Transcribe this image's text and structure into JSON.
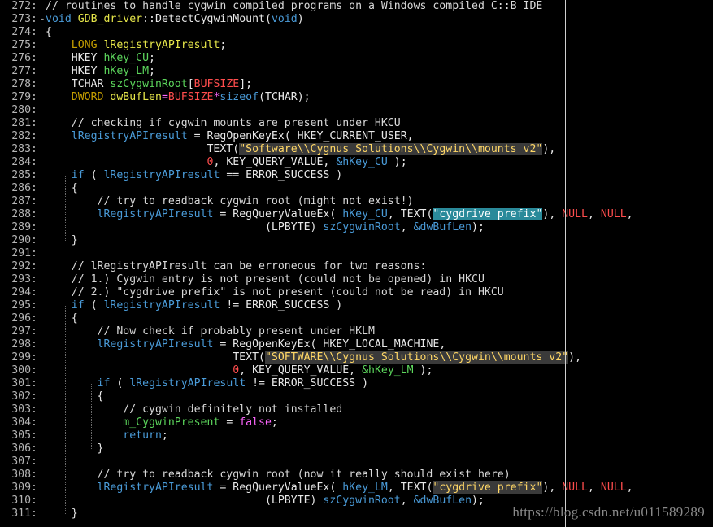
{
  "colors": {
    "background": "#000000",
    "line_number": "#b4b4b4",
    "comment": "#d8d8d8",
    "plain": "#e8e8e8",
    "keyword": "#4a9bd8",
    "type_keyword": "#c7a000",
    "identifier_yellow": "#e6e64a",
    "variable_green": "#5cd65c",
    "string": "#ffd766",
    "macro": "#ff4d4d",
    "number": "#ff4d4d",
    "operator": "#ff66ff",
    "highlight_bg": "#2a8a9a"
  },
  "lines": [
    {
      "n": "272:",
      "tokens": [
        {
          "t": "// routines to handle cygwin compiled programs on a Windows compiled C::B IDE",
          "c": "comment"
        }
      ]
    },
    {
      "n": "273:",
      "fold": true,
      "tokens": [
        {
          "t": "void ",
          "c": "keyword"
        },
        {
          "t": "GDB_driver",
          "c": "identifier_yellow"
        },
        {
          "t": "::",
          "c": "plain"
        },
        {
          "t": "DetectCygwinMount",
          "c": "plain"
        },
        {
          "t": "(",
          "c": "plain"
        },
        {
          "t": "void",
          "c": "keyword"
        },
        {
          "t": ")",
          "c": "plain"
        }
      ]
    },
    {
      "n": "274:",
      "tokens": [
        {
          "t": "{",
          "c": "plain"
        }
      ]
    },
    {
      "n": "275:",
      "tokens": [
        {
          "t": "    LONG ",
          "c": "type_keyword"
        },
        {
          "t": "lRegistryAPIresult",
          "c": "identifier_yellow"
        },
        {
          "t": ";",
          "c": "plain"
        }
      ]
    },
    {
      "n": "276:",
      "tokens": [
        {
          "t": "    HKEY ",
          "c": "plain"
        },
        {
          "t": "hKey_CU",
          "c": "variable_green"
        },
        {
          "t": ";",
          "c": "plain"
        }
      ]
    },
    {
      "n": "277:",
      "tokens": [
        {
          "t": "    HKEY ",
          "c": "plain"
        },
        {
          "t": "hKey_LM",
          "c": "variable_green"
        },
        {
          "t": ";",
          "c": "plain"
        }
      ]
    },
    {
      "n": "278:",
      "tokens": [
        {
          "t": "    TCHAR ",
          "c": "plain"
        },
        {
          "t": "szCygwinRoot",
          "c": "variable_green"
        },
        {
          "t": "[",
          "c": "plain"
        },
        {
          "t": "BUFSIZE",
          "c": "macro"
        },
        {
          "t": "];",
          "c": "plain"
        }
      ]
    },
    {
      "n": "279:",
      "tokens": [
        {
          "t": "    DWORD ",
          "c": "type_keyword"
        },
        {
          "t": "dwBufLen",
          "c": "identifier_yellow"
        },
        {
          "t": "=",
          "c": "operator"
        },
        {
          "t": "BUFSIZE",
          "c": "macro"
        },
        {
          "t": "*",
          "c": "operator"
        },
        {
          "t": "sizeof",
          "c": "keyword"
        },
        {
          "t": "(TCHAR);",
          "c": "plain"
        }
      ]
    },
    {
      "n": "280:",
      "tokens": []
    },
    {
      "n": "281:",
      "tokens": [
        {
          "t": "    // checking if cygwin mounts are present under HKCU",
          "c": "comment"
        }
      ]
    },
    {
      "n": "282:",
      "tokens": [
        {
          "t": "    lRegistryAPIresult ",
          "c": "keyword"
        },
        {
          "t": "= ",
          "c": "plain"
        },
        {
          "t": "RegOpenKeyEx( HKEY_CURRENT_USER,",
          "c": "plain"
        }
      ]
    },
    {
      "n": "283:",
      "tokens": [
        {
          "t": "                         TEXT(",
          "c": "plain"
        },
        {
          "t": "\"Software\\\\Cygnus Solutions\\\\Cygwin\\\\mounts v2\"",
          "c": "string",
          "hl": "str"
        },
        {
          "t": "),",
          "c": "plain"
        }
      ]
    },
    {
      "n": "284:",
      "tokens": [
        {
          "t": "                         ",
          "c": "plain"
        },
        {
          "t": "0",
          "c": "number"
        },
        {
          "t": ", KEY_QUERY_VALUE, ",
          "c": "plain"
        },
        {
          "t": "&hKey_CU",
          "c": "keyword"
        },
        {
          "t": " );",
          "c": "plain"
        }
      ]
    },
    {
      "n": "285:",
      "tokens": [
        {
          "t": "    if ",
          "c": "keyword"
        },
        {
          "t": "( ",
          "c": "plain"
        },
        {
          "t": "lRegistryAPIresult ",
          "c": "keyword"
        },
        {
          "t": "== ERROR_SUCCESS )",
          "c": "plain"
        }
      ]
    },
    {
      "n": "286:",
      "tokens": [
        {
          "t": "    {",
          "c": "plain"
        }
      ]
    },
    {
      "n": "287:",
      "tokens": [
        {
          "t": "        // try to readback cygwin root (might not exist!)",
          "c": "comment"
        }
      ]
    },
    {
      "n": "288:",
      "tokens": [
        {
          "t": "        lRegistryAPIresult ",
          "c": "keyword"
        },
        {
          "t": "= ",
          "c": "plain"
        },
        {
          "t": "RegQueryValueEx( ",
          "c": "plain"
        },
        {
          "t": "hKey_CU",
          "c": "keyword"
        },
        {
          "t": ", TEXT(",
          "c": "plain"
        },
        {
          "t": "\"cygdrive prefix\"",
          "c": "string",
          "hl": "sel"
        },
        {
          "t": "), ",
          "c": "plain"
        },
        {
          "t": "NULL",
          "c": "macro"
        },
        {
          "t": ", ",
          "c": "plain"
        },
        {
          "t": "NULL",
          "c": "macro"
        },
        {
          "t": ",",
          "c": "plain"
        }
      ]
    },
    {
      "n": "289:",
      "tokens": [
        {
          "t": "                                  (LPBYTE) ",
          "c": "plain"
        },
        {
          "t": "szCygwinRoot",
          "c": "keyword"
        },
        {
          "t": ", ",
          "c": "plain"
        },
        {
          "t": "&dwBufLen",
          "c": "keyword"
        },
        {
          "t": ");",
          "c": "plain"
        }
      ]
    },
    {
      "n": "290:",
      "tokens": [
        {
          "t": "    }",
          "c": "plain"
        }
      ]
    },
    {
      "n": "291:",
      "tokens": []
    },
    {
      "n": "292:",
      "tokens": [
        {
          "t": "    // lRegistryAPIresult can be erroneous for two reasons:",
          "c": "comment"
        }
      ]
    },
    {
      "n": "293:",
      "tokens": [
        {
          "t": "    // 1.) Cygwin entry is not present (could not be opened) in HKCU",
          "c": "comment"
        }
      ]
    },
    {
      "n": "294:",
      "tokens": [
        {
          "t": "    // 2.) \"cygdrive prefix\" is not present (could not be read) in HKCU",
          "c": "comment"
        }
      ]
    },
    {
      "n": "295:",
      "tokens": [
        {
          "t": "    if ",
          "c": "keyword"
        },
        {
          "t": "( ",
          "c": "plain"
        },
        {
          "t": "lRegistryAPIresult ",
          "c": "keyword"
        },
        {
          "t": "!= ERROR_SUCCESS )",
          "c": "plain"
        }
      ]
    },
    {
      "n": "296:",
      "tokens": [
        {
          "t": "    {",
          "c": "plain"
        }
      ]
    },
    {
      "n": "297:",
      "tokens": [
        {
          "t": "        // Now check if probably present under HKLM",
          "c": "comment"
        }
      ]
    },
    {
      "n": "298:",
      "tokens": [
        {
          "t": "        lRegistryAPIresult ",
          "c": "keyword"
        },
        {
          "t": "= ",
          "c": "plain"
        },
        {
          "t": "RegOpenKeyEx( HKEY_LOCAL_MACHINE,",
          "c": "plain"
        }
      ]
    },
    {
      "n": "299:",
      "tokens": [
        {
          "t": "                             TEXT(",
          "c": "plain"
        },
        {
          "t": "\"SOFTWARE\\\\Cygnus Solutions\\\\Cygwin\\\\mounts v2\"",
          "c": "string",
          "hl": "str"
        },
        {
          "t": "),",
          "c": "plain"
        }
      ]
    },
    {
      "n": "300:",
      "tokens": [
        {
          "t": "                             ",
          "c": "plain"
        },
        {
          "t": "0",
          "c": "number"
        },
        {
          "t": ", KEY_QUERY_VALUE, ",
          "c": "plain"
        },
        {
          "t": "&hKey_LM",
          "c": "variable_green"
        },
        {
          "t": " );",
          "c": "plain"
        }
      ]
    },
    {
      "n": "301:",
      "tokens": [
        {
          "t": "        if ",
          "c": "keyword"
        },
        {
          "t": "( ",
          "c": "plain"
        },
        {
          "t": "lRegistryAPIresult ",
          "c": "keyword"
        },
        {
          "t": "!= ERROR_SUCCESS )",
          "c": "plain"
        }
      ]
    },
    {
      "n": "302:",
      "tokens": [
        {
          "t": "        {",
          "c": "plain"
        }
      ]
    },
    {
      "n": "303:",
      "tokens": [
        {
          "t": "            // cygwin definitely not installed",
          "c": "comment"
        }
      ]
    },
    {
      "n": "304:",
      "tokens": [
        {
          "t": "            m_CygwinPresent ",
          "c": "variable_green"
        },
        {
          "t": "= ",
          "c": "plain"
        },
        {
          "t": "false",
          "c": "operator"
        },
        {
          "t": ";",
          "c": "plain"
        }
      ]
    },
    {
      "n": "305:",
      "tokens": [
        {
          "t": "            return",
          "c": "keyword"
        },
        {
          "t": ";",
          "c": "plain"
        }
      ]
    },
    {
      "n": "306:",
      "tokens": [
        {
          "t": "        }",
          "c": "plain"
        }
      ]
    },
    {
      "n": "307:",
      "tokens": []
    },
    {
      "n": "308:",
      "tokens": [
        {
          "t": "        // try to readback cygwin root (now it really should exist here)",
          "c": "comment"
        }
      ]
    },
    {
      "n": "309:",
      "tokens": [
        {
          "t": "        lRegistryAPIresult ",
          "c": "keyword"
        },
        {
          "t": "= ",
          "c": "plain"
        },
        {
          "t": "RegQueryValueEx( ",
          "c": "plain"
        },
        {
          "t": "hKey_LM",
          "c": "keyword"
        },
        {
          "t": ", TEXT(",
          "c": "plain"
        },
        {
          "t": "\"cygdrive prefix\"",
          "c": "string",
          "hl": "str"
        },
        {
          "t": "), ",
          "c": "plain"
        },
        {
          "t": "NULL",
          "c": "macro"
        },
        {
          "t": ", ",
          "c": "plain"
        },
        {
          "t": "NULL",
          "c": "macro"
        },
        {
          "t": ",",
          "c": "plain"
        }
      ]
    },
    {
      "n": "310:",
      "tokens": [
        {
          "t": "                                  (LPBYTE) ",
          "c": "plain"
        },
        {
          "t": "szCygwinRoot",
          "c": "keyword"
        },
        {
          "t": ", ",
          "c": "plain"
        },
        {
          "t": "&dwBufLen",
          "c": "keyword"
        },
        {
          "t": ");",
          "c": "plain"
        }
      ]
    },
    {
      "n": "311:",
      "tokens": [
        {
          "t": "    }",
          "c": "plain"
        }
      ]
    }
  ],
  "watermark": "https://blog.csdn.net/u011589289"
}
